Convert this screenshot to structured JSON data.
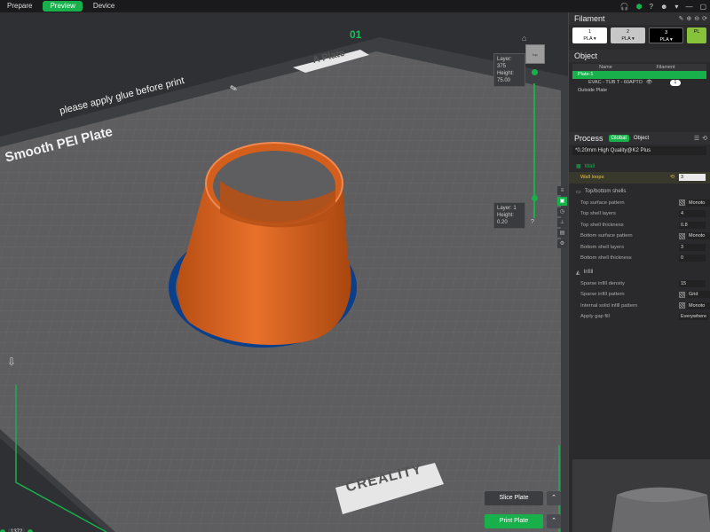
{
  "topbar": {
    "tabs": [
      {
        "label": "Prepare",
        "active": false
      },
      {
        "label": "Preview",
        "active": true
      },
      {
        "label": "Device",
        "active": false
      }
    ]
  },
  "viewport": {
    "plate_number": "01",
    "plate_name": "A Plate",
    "glue_note": "please apply glue before print",
    "plate_type": "Smooth PEI Plate",
    "brand": "CREALITY",
    "layer_top": {
      "line1": "Layer: 375",
      "line2": "Height: 75.00"
    },
    "layer_bottom": {
      "line1": "Layer: 1",
      "line2": "Height: 0.20"
    },
    "navcube_label": "top",
    "bottom_value": "1372",
    "slice_label": "Slice Plate",
    "print_label": "Print Plate"
  },
  "panel": {
    "filament_title": "Filament",
    "filaments": [
      {
        "num": "1",
        "type": "PLA ▾",
        "color": "#ffffff"
      },
      {
        "num": "2",
        "type": "PLA ▾",
        "color": "#c7c7c7"
      },
      {
        "num": "3",
        "type": "PLA ▾",
        "color": "#000000"
      },
      {
        "num": "",
        "type": "PL",
        "color": "#86c23a"
      }
    ],
    "object_title": "Object",
    "object_cols": [
      "Name",
      "Filament"
    ],
    "objects": [
      {
        "name": "Plate-1",
        "selected": true,
        "badge": ""
      },
      {
        "name": "EVAC - TUB T - 60APTO",
        "selected": false,
        "badge": "1"
      },
      {
        "name": "Outside Plate",
        "selected": false,
        "badge": ""
      }
    ],
    "process_title": "Process",
    "process_tabs": [
      "Global",
      "Object"
    ],
    "preset": "*0.20mm High Quality@K2 Plus",
    "wall_group": "Wall",
    "wall_loops_label": "Wall loops",
    "wall_loops_value": "3",
    "topbottom_group": "Top/bottom shells",
    "topbottom_rows": [
      {
        "label": "Top surface pattern",
        "value": "Monoto",
        "pattern": true
      },
      {
        "label": "Top shell layers",
        "value": "4",
        "pattern": false
      },
      {
        "label": "Top shell thickness",
        "value": "0.8",
        "pattern": false
      },
      {
        "label": "Bottom surface pattern",
        "value": "Monoto",
        "pattern": true
      },
      {
        "label": "Bottom shell layers",
        "value": "3",
        "pattern": false
      },
      {
        "label": "Bottom shell thickness",
        "value": "0",
        "pattern": false
      }
    ],
    "infill_group": "Infill",
    "infill_rows": [
      {
        "label": "Sparse infill density",
        "value": "15",
        "pattern": false
      },
      {
        "label": "Sparse infill pattern",
        "value": "Grid",
        "pattern": true
      },
      {
        "label": "Internal solid infill pattern",
        "value": "Monoto",
        "pattern": true
      },
      {
        "label": "Apply gap fill",
        "value": "Everywhere",
        "pattern": false
      }
    ]
  },
  "colors": {
    "accent": "#17b04b",
    "model": "#e0651d",
    "brim": "#0b3f8a",
    "bed": "#5e5e60"
  }
}
